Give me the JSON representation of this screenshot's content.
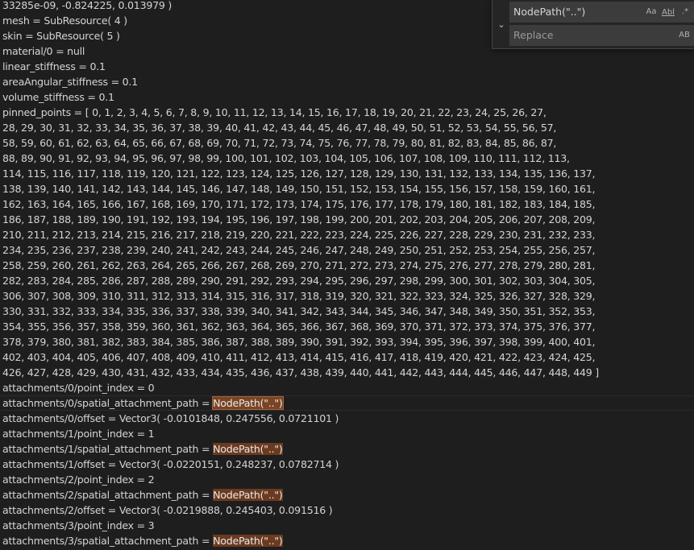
{
  "editor": {
    "lines": [
      {
        "text": "33285e-09, -0.824225, 0.013979 )"
      },
      {
        "text": "mesh = SubResource( 4 )"
      },
      {
        "text": "skin = SubResource( 5 )"
      },
      {
        "text": "material/0 = null"
      },
      {
        "text": "linear_stiffness = 0.1"
      },
      {
        "text": "areaAngular_stiffness = 0.1"
      },
      {
        "text": "volume_stiffness = 0.1"
      },
      {
        "text": "pinned_points = [ 0, 1, 2, 3, 4, 5, 6, 7, 8, 9, 10, 11, 12, 13, 14, 15, 16, 17, 18, 19, 20, 21, 22, 23, 24, 25, 26, 27,"
      },
      {
        "text": "28, 29, 30, 31, 32, 33, 34, 35, 36, 37, 38, 39, 40, 41, 42, 43, 44, 45, 46, 47, 48, 49, 50, 51, 52, 53, 54, 55, 56, 57,"
      },
      {
        "text": "58, 59, 60, 61, 62, 63, 64, 65, 66, 67, 68, 69, 70, 71, 72, 73, 74, 75, 76, 77, 78, 79, 80, 81, 82, 83, 84, 85, 86, 87,"
      },
      {
        "text": "88, 89, 90, 91, 92, 93, 94, 95, 96, 97, 98, 99, 100, 101, 102, 103, 104, 105, 106, 107, 108, 109, 110, 111, 112, 113,"
      },
      {
        "text": "114, 115, 116, 117, 118, 119, 120, 121, 122, 123, 124, 125, 126, 127, 128, 129, 130, 131, 132, 133, 134, 135, 136, 137,"
      },
      {
        "text": "138, 139, 140, 141, 142, 143, 144, 145, 146, 147, 148, 149, 150, 151, 152, 153, 154, 155, 156, 157, 158, 159, 160, 161,"
      },
      {
        "text": "162, 163, 164, 165, 166, 167, 168, 169, 170, 171, 172, 173, 174, 175, 176, 177, 178, 179, 180, 181, 182, 183, 184, 185,"
      },
      {
        "text": "186, 187, 188, 189, 190, 191, 192, 193, 194, 195, 196, 197, 198, 199, 200, 201, 202, 203, 204, 205, 206, 207, 208, 209,"
      },
      {
        "text": "210, 211, 212, 213, 214, 215, 216, 217, 218, 219, 220, 221, 222, 223, 224, 225, 226, 227, 228, 229, 230, 231, 232, 233,"
      },
      {
        "text": "234, 235, 236, 237, 238, 239, 240, 241, 242, 243, 244, 245, 246, 247, 248, 249, 250, 251, 252, 253, 254, 255, 256, 257,"
      },
      {
        "text": "258, 259, 260, 261, 262, 263, 264, 265, 266, 267, 268, 269, 270, 271, 272, 273, 274, 275, 276, 277, 278, 279, 280, 281,"
      },
      {
        "text": "282, 283, 284, 285, 286, 287, 288, 289, 290, 291, 292, 293, 294, 295, 296, 297, 298, 299, 300, 301, 302, 303, 304, 305,"
      },
      {
        "text": "306, 307, 308, 309, 310, 311, 312, 313, 314, 315, 316, 317, 318, 319, 320, 321, 322, 323, 324, 325, 326, 327, 328, 329,"
      },
      {
        "text": "330, 331, 332, 333, 334, 335, 336, 337, 338, 339, 340, 341, 342, 343, 344, 345, 346, 347, 348, 349, 350, 351, 352, 353,"
      },
      {
        "text": "354, 355, 356, 357, 358, 359, 360, 361, 362, 363, 364, 365, 366, 367, 368, 369, 370, 371, 372, 373, 374, 375, 376, 377,"
      },
      {
        "text": "378, 379, 380, 381, 382, 383, 384, 385, 386, 387, 388, 389, 390, 391, 392, 393, 394, 395, 396, 397, 398, 399, 400, 401,"
      },
      {
        "text": "402, 403, 404, 405, 406, 407, 408, 409, 410, 411, 412, 413, 414, 415, 416, 417, 418, 419, 420, 421, 422, 423, 424, 425,"
      },
      {
        "text": "426, 427, 428, 429, 430, 431, 432, 433, 434, 435, 436, 437, 438, 439, 440, 441, 442, 443, 444, 445, 446, 447, 448, 449 ]"
      },
      {
        "text": "attachments/0/point_index = 0"
      },
      {
        "text": "attachments/0/spatial_attachment_path = ",
        "match": "NodePath(\"..\")",
        "current": true
      },
      {
        "text": "attachments/0/offset = Vector3( -0.0101848, 0.247556, 0.0721101 )"
      },
      {
        "text": "attachments/1/point_index = 1"
      },
      {
        "text": "attachments/1/spatial_attachment_path = ",
        "match": "NodePath(\"..\")"
      },
      {
        "text": "attachments/1/offset = Vector3( -0.0220151, 0.248237, 0.0782714 )"
      },
      {
        "text": "attachments/2/point_index = 2"
      },
      {
        "text": "attachments/2/spatial_attachment_path = ",
        "match": "NodePath(\"..\")"
      },
      {
        "text": "attachments/2/offset = Vector3( -0.0219888, 0.245403, 0.091516 )"
      },
      {
        "text": "attachments/3/point_index = 3"
      },
      {
        "text": "attachments/3/spatial_attachment_path = ",
        "match": "NodePath(\"..\")"
      }
    ]
  },
  "find_widget": {
    "toggle_icon": "chevron-down-icon",
    "find_value": "NodePath(\"..\")",
    "replace_placeholder": "Replace",
    "options": {
      "match_case": "Aa",
      "whole_word": "Abl",
      "regex": ".*",
      "preserve_case": "AB"
    }
  },
  "colors": {
    "background": "#1e1e1e",
    "text": "#d4d4d4",
    "match_highlight": "#6b3a1f",
    "widget_background": "#252526",
    "input_background": "#3c3c3c"
  }
}
